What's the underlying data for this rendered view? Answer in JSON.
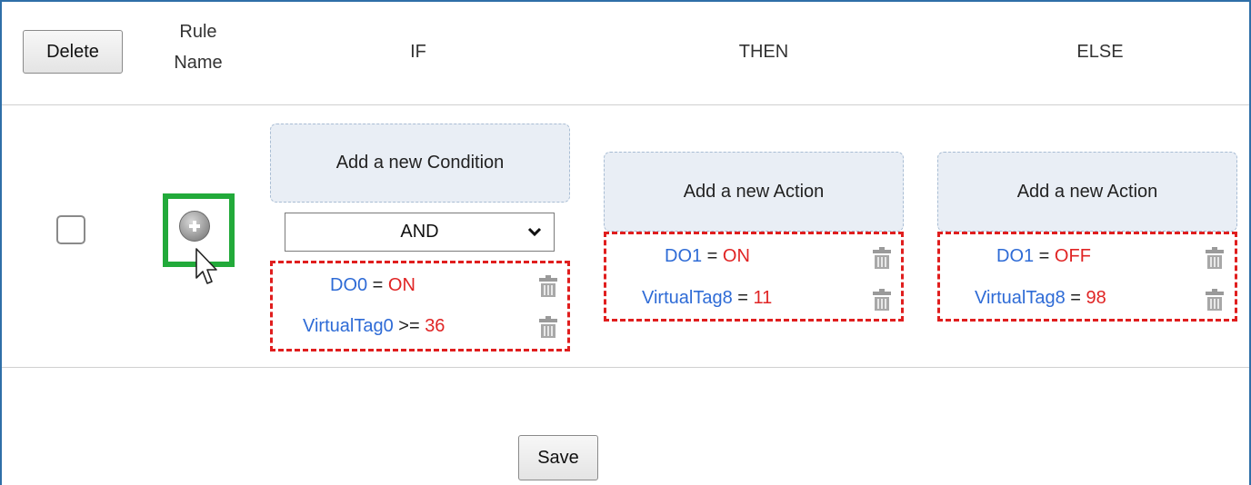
{
  "header": {
    "delete_label": "Delete",
    "rule_name_line1": "Rule",
    "rule_name_line2": "Name",
    "if_label": "IF",
    "then_label": "THEN",
    "else_label": "ELSE"
  },
  "row": {
    "checkbox_checked": false,
    "add_rule_icon": "plus-circle-icon",
    "if_col": {
      "add_label": "Add a new Condition",
      "operator": "AND",
      "conditions": [
        {
          "tag": "DO0",
          "op": " = ",
          "value": "ON"
        },
        {
          "tag": "VirtualTag0",
          "op": " >= ",
          "value": "36"
        }
      ]
    },
    "then_col": {
      "add_label": "Add a new Action",
      "actions": [
        {
          "tag": "DO1",
          "op": " = ",
          "value": "ON"
        },
        {
          "tag": "VirtualTag8",
          "op": " = ",
          "value": "11"
        }
      ]
    },
    "else_col": {
      "add_label": "Add a new Action",
      "actions": [
        {
          "tag": "DO1",
          "op": " = ",
          "value": "OFF"
        },
        {
          "tag": "VirtualTag8",
          "op": " = ",
          "value": "98"
        }
      ]
    }
  },
  "footer": {
    "save_label": "Save"
  },
  "colors": {
    "tag": "#2e6bd6",
    "value": "#e02424",
    "highlight": "#22aa3a",
    "frame": "#2f6fa8"
  }
}
